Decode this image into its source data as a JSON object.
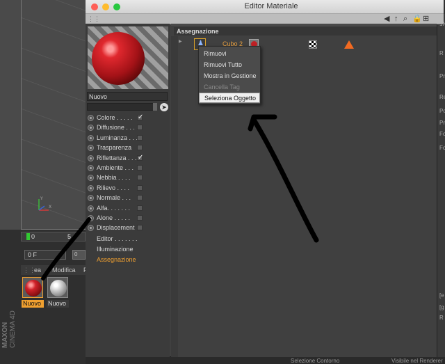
{
  "window": {
    "title": "Editor Materiale"
  },
  "material": {
    "name": "Nuovo",
    "channels": [
      {
        "label": "Colore . . . . .",
        "checked": true
      },
      {
        "label": "Diffusione . . .",
        "checked": false
      },
      {
        "label": "Luminanza . . .",
        "checked": false
      },
      {
        "label": "Trasparenza",
        "checked": false
      },
      {
        "label": "Riflettanza . . .",
        "checked": true
      },
      {
        "label": "Ambiente . . .",
        "checked": false
      },
      {
        "label": "Nebbia . . . .",
        "checked": false
      },
      {
        "label": "Rilievo . . . .",
        "checked": false
      },
      {
        "label": "Normale . . .",
        "checked": false
      },
      {
        "label": "Alfa. . . . . . .",
        "checked": false
      },
      {
        "label": "Alone . . . . .",
        "checked": false
      },
      {
        "label": "Displacement",
        "checked": false
      }
    ],
    "extra": [
      "Editor . . . . . . .",
      "Illuminazione",
      "Assegnazione"
    ]
  },
  "assign": {
    "header": "Assegnazione",
    "object_name": "Cubo 2"
  },
  "context_menu": {
    "items": [
      "Rimuovi",
      "Rimuovi Tutto",
      "Mostra in Gestione",
      "Cancella Tag",
      "Seleziona Oggetto"
    ]
  },
  "background": {
    "timeline_start": "0",
    "timeline_tick": "5",
    "frame_value": "0 F",
    "frame_btn": "0",
    "manager_menu": [
      "ea",
      "Modifica",
      "F"
    ],
    "materials": [
      "Nuovo",
      "Nuovo"
    ],
    "brand_line1": "MAXON",
    "brand_line2": "CINEMA 4D",
    "bottom_text_left": "Selezione Contorno",
    "bottom_text_right": "Visibile nel Renderer",
    "right_strip": [
      "1N",
      "R",
      "Pr",
      "Re",
      "Po",
      "Pr",
      "Fo",
      "Fo",
      "[e",
      "[g",
      "R"
    ]
  },
  "colors": {
    "accent": "#f0a030",
    "selected_material": "#f0a030",
    "warning": "#f26a21"
  }
}
